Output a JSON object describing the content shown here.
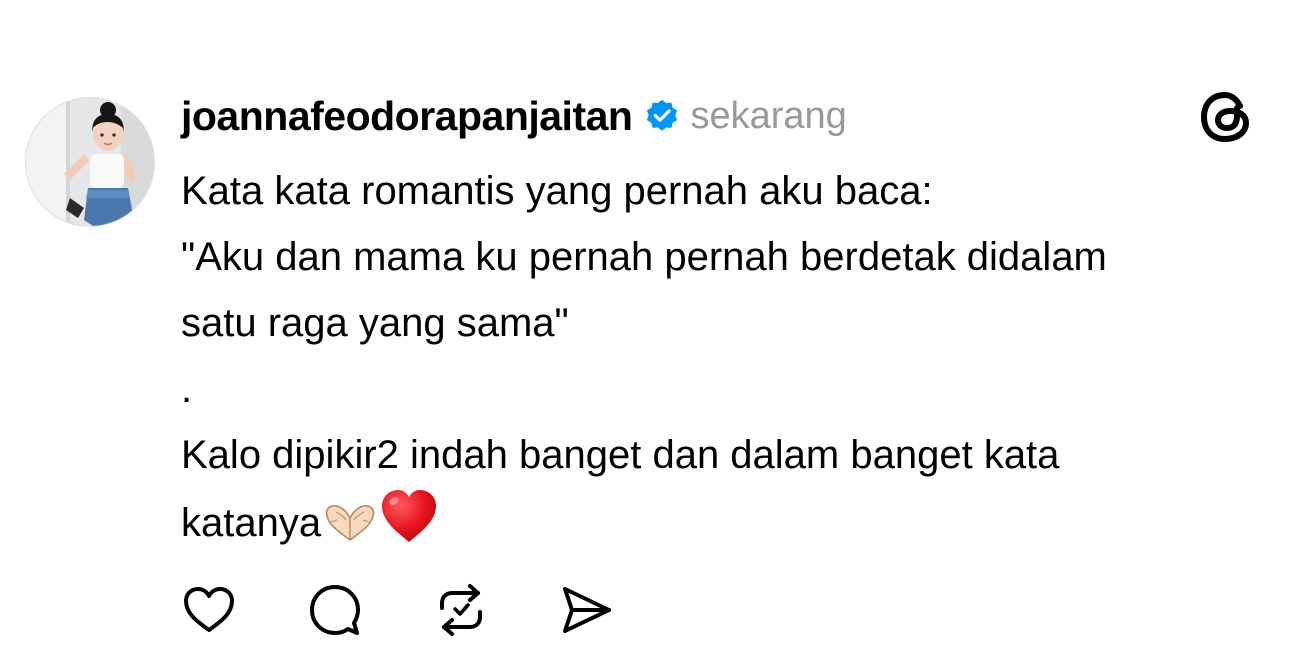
{
  "post": {
    "username": "joannafeodorapanjaitan",
    "verified": true,
    "timestamp": "sekarang",
    "lines": [
      "Kata kata romantis yang pernah aku baca:",
      "\"Aku dan mama ku pernah pernah berdetak didalam",
      "satu raga yang sama\"",
      ".",
      "Kalo dipikir2 indah banget dan dalam banget kata",
      "katanya"
    ],
    "trailing_emojis": [
      "heart-hands-emoji",
      "red-heart-emoji"
    ]
  },
  "icons": {
    "avatar": "profile-photo",
    "verified": "verified-badge-icon",
    "logo": "threads-logo-icon",
    "like": "heart-icon",
    "reply": "comment-icon",
    "repost": "repost-icon",
    "share": "send-icon"
  },
  "colors": {
    "verified_blue": "#0095f6",
    "timestamp_gray": "#999999",
    "text": "#000000",
    "background": "#ffffff"
  }
}
